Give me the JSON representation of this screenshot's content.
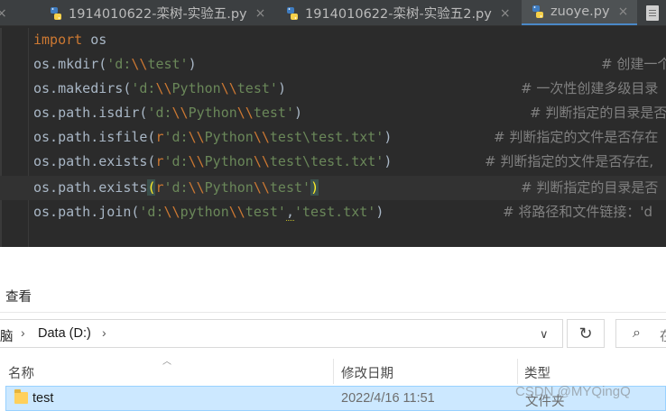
{
  "editor": {
    "tabs": [
      {
        "label": "1914010622-栾树-实验五.py",
        "active": false
      },
      {
        "label": "1914010622-栾树-实验五2.py",
        "active": false
      },
      {
        "label": "zuoye.py",
        "active": true
      }
    ],
    "tab_close_glyph": "×",
    "lines": [
      {
        "code": "import os",
        "comment": ""
      },
      {
        "code": "os.mkdir('d:\\\\test')",
        "comment": "# 创建一个"
      },
      {
        "code": "os.makedirs('d:\\\\Python\\\\test')",
        "comment": "# 一次性创建多级目录"
      },
      {
        "code": "os.path.isdir('d:\\\\Python\\\\test')",
        "comment": "# 判断指定的目录是否"
      },
      {
        "code": "os.path.isfile(r'd:\\\\Python\\\\test\\test.txt')",
        "comment": "# 判断指定的文件是否存在"
      },
      {
        "code": "os.path.exists(r'd:\\\\Python\\\\test\\test.txt')",
        "comment": "# 判断指定的文件是否存在,"
      },
      {
        "code": "os.path.exists(r'd:\\\\Python\\\\test')",
        "comment": "# 判断指定的目录是否"
      },
      {
        "code": "os.path.join('d:\\\\python\\\\test','test.txt')",
        "comment": "# 将路径和文件链接：'d"
      }
    ],
    "colors": {
      "background": "#2b2b2b",
      "keyword": "#cc7832",
      "string": "#6a8759",
      "comment": "#808080",
      "text": "#a9b7c6"
    }
  },
  "explorer": {
    "ribbon_tab": "查看",
    "breadcrumb": [
      "脑",
      "Data (D:)"
    ],
    "search_placeholder": "在",
    "columns": [
      "名称",
      "修改日期",
      "类型"
    ],
    "rows": [
      {
        "name": "test",
        "modified": "2022/4/16 11:51",
        "type": "文件夹",
        "selected": true
      }
    ],
    "icons": {
      "refresh": "refresh-icon",
      "search": "search-icon",
      "folder": "folder-icon"
    }
  },
  "watermark": "CSDN @MYQingQ"
}
